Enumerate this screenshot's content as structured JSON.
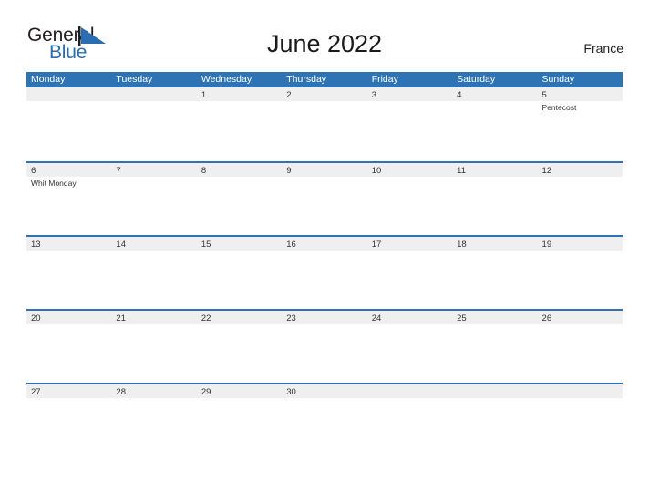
{
  "brand": {
    "name_part1": "General",
    "name_part2": "Blue",
    "flag_color": "#2a6db0"
  },
  "header": {
    "title": "June 2022",
    "country": "France"
  },
  "theme": {
    "header_blue": "#2e74b5",
    "row_band_gray": "#efefef",
    "text_dark": "#333333"
  },
  "calendar": {
    "weekdays": [
      "Monday",
      "Tuesday",
      "Wednesday",
      "Thursday",
      "Friday",
      "Saturday",
      "Sunday"
    ],
    "weeks": [
      [
        {
          "day": "",
          "events": []
        },
        {
          "day": "",
          "events": []
        },
        {
          "day": "1",
          "events": []
        },
        {
          "day": "2",
          "events": []
        },
        {
          "day": "3",
          "events": []
        },
        {
          "day": "4",
          "events": []
        },
        {
          "day": "5",
          "events": [
            "Pentecost"
          ]
        }
      ],
      [
        {
          "day": "6",
          "events": [
            "Whit Monday"
          ]
        },
        {
          "day": "7",
          "events": []
        },
        {
          "day": "8",
          "events": []
        },
        {
          "day": "9",
          "events": []
        },
        {
          "day": "10",
          "events": []
        },
        {
          "day": "11",
          "events": []
        },
        {
          "day": "12",
          "events": []
        }
      ],
      [
        {
          "day": "13",
          "events": []
        },
        {
          "day": "14",
          "events": []
        },
        {
          "day": "15",
          "events": []
        },
        {
          "day": "16",
          "events": []
        },
        {
          "day": "17",
          "events": []
        },
        {
          "day": "18",
          "events": []
        },
        {
          "day": "19",
          "events": []
        }
      ],
      [
        {
          "day": "20",
          "events": []
        },
        {
          "day": "21",
          "events": []
        },
        {
          "day": "22",
          "events": []
        },
        {
          "day": "23",
          "events": []
        },
        {
          "day": "24",
          "events": []
        },
        {
          "day": "25",
          "events": []
        },
        {
          "day": "26",
          "events": []
        }
      ],
      [
        {
          "day": "27",
          "events": []
        },
        {
          "day": "28",
          "events": []
        },
        {
          "day": "29",
          "events": []
        },
        {
          "day": "30",
          "events": []
        },
        {
          "day": "",
          "events": []
        },
        {
          "day": "",
          "events": []
        },
        {
          "day": "",
          "events": []
        }
      ]
    ]
  }
}
